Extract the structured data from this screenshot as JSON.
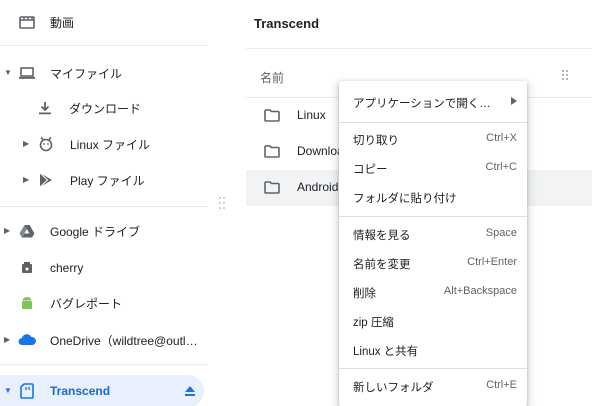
{
  "sidebar": {
    "items": [
      {
        "label": "動画",
        "icon": "video-folder-icon"
      },
      {
        "label": "マイファイル",
        "icon": "laptop-icon"
      },
      {
        "label": "ダウンロード",
        "icon": "download-icon"
      },
      {
        "label": "Linux ファイル",
        "icon": "linux-icon"
      },
      {
        "label": "Play ファイル",
        "icon": "play-store-icon"
      },
      {
        "label": "Google ドライブ",
        "icon": "google-drive-icon"
      },
      {
        "label": "cherry",
        "icon": "removable-drive-icon"
      },
      {
        "label": "バグレポート",
        "icon": "android-icon"
      },
      {
        "label": "OneDrive（wildtree@outl…",
        "icon": "onedrive-cloud-icon"
      },
      {
        "label": "Transcend",
        "icon": "sd-card-icon"
      }
    ]
  },
  "main": {
    "title": "Transcend",
    "column_name": "名前",
    "files": [
      {
        "name": "Linux"
      },
      {
        "name": "Downloa"
      },
      {
        "name": "Android"
      }
    ]
  },
  "context_menu": {
    "items": [
      {
        "label": "アプリケーションで開く…",
        "shortcut": ""
      },
      {
        "label": "切り取り",
        "shortcut": "Ctrl+X"
      },
      {
        "label": "コピー",
        "shortcut": "Ctrl+C"
      },
      {
        "label": "フォルダに貼り付け",
        "shortcut": ""
      },
      {
        "label": "情報を見る",
        "shortcut": "Space"
      },
      {
        "label": "名前を変更",
        "shortcut": "Ctrl+Enter"
      },
      {
        "label": "削除",
        "shortcut": "Alt+Backspace"
      },
      {
        "label": "zip 圧縮",
        "shortcut": ""
      },
      {
        "label": "Linux と共有",
        "shortcut": ""
      },
      {
        "label": "新しいフォルダ",
        "shortcut": "Ctrl+E"
      }
    ]
  },
  "colors": {
    "accent": "#1a73e8",
    "selected_bg": "#e8f0fe",
    "selected_text": "#1967d2",
    "icon_gray": "#5f6368"
  }
}
